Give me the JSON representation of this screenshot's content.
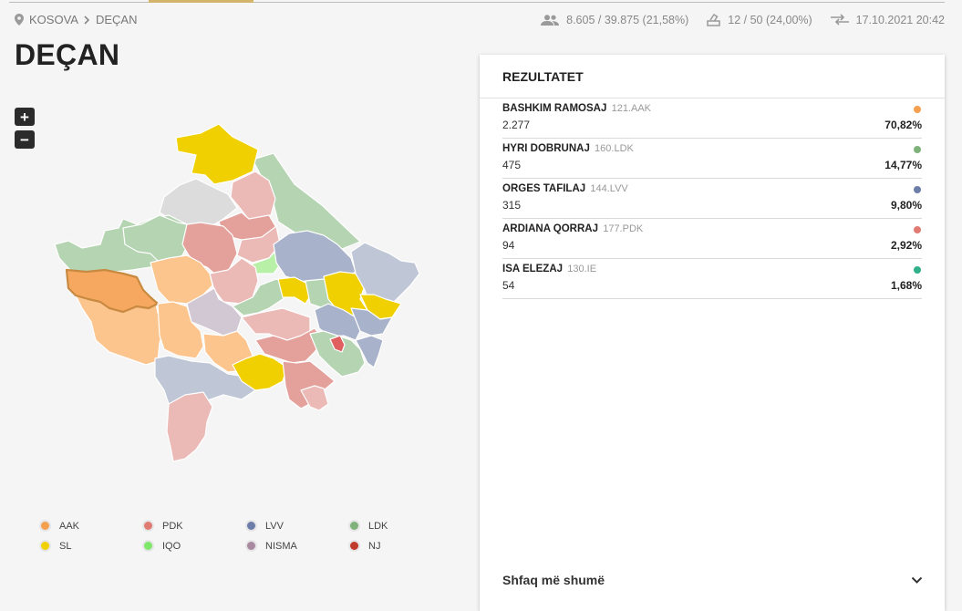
{
  "breadcrumb": {
    "root": "KOSOVA",
    "current": "DEÇAN"
  },
  "stats": {
    "turnout": "8.605 / 39.875 (21,58%)",
    "stations": "12 / 50 (24,00%)",
    "updated": "17.10.2021 20:42"
  },
  "title": "DEÇAN",
  "zoom": {
    "in": "+",
    "out": "−"
  },
  "panel": {
    "title": "REZULTATET",
    "results": [
      {
        "name": "BASHKIM RAMOSAJ",
        "party": "121.AAK",
        "votes": "2.277",
        "percent": "70,82%",
        "color": "#f5a04e"
      },
      {
        "name": "HYRI DOBRUNAJ",
        "party": "160.LDK",
        "votes": "475",
        "percent": "14,77%",
        "color": "#7fb27a"
      },
      {
        "name": "ORGES TAFILAJ",
        "party": "144.LVV",
        "votes": "315",
        "percent": "9,80%",
        "color": "#6b7da8"
      },
      {
        "name": "ARDIANA QORRAJ",
        "party": "177.PDK",
        "votes": "94",
        "percent": "2,92%",
        "color": "#e07b73"
      },
      {
        "name": "ISA ELEZAJ",
        "party": "130.IE",
        "votes": "54",
        "percent": "1,68%",
        "color": "#2fb08a"
      }
    ],
    "show_more": "Shfaq më shumë"
  },
  "legend": [
    {
      "label": "AAK",
      "color": "#f5a04e"
    },
    {
      "label": "PDK",
      "color": "#e07b73"
    },
    {
      "label": "LVV",
      "color": "#6b7da8"
    },
    {
      "label": "LDK",
      "color": "#7fb27a"
    },
    {
      "label": "SL",
      "color": "#f0d000"
    },
    {
      "label": "IQO",
      "color": "#7ee86a"
    },
    {
      "label": "NISMA",
      "color": "#a8899f"
    },
    {
      "label": "NJ",
      "color": "#c0392b"
    }
  ],
  "map_colors": {
    "aak_light": "#fcc58e",
    "aak_selected": "#f7a860",
    "pdk_light": "#ebb9b6",
    "pdk": "#e4a09b",
    "lvv_light": "#bfc7d6",
    "lvv": "#a8b3cb",
    "ldk_light": "#b5d4b2",
    "sl": "#f0d000",
    "iqo": "#b8f0a8",
    "nisma": "#d2c8d4",
    "gray": "#dcdcdc",
    "nj": "#e06060"
  }
}
